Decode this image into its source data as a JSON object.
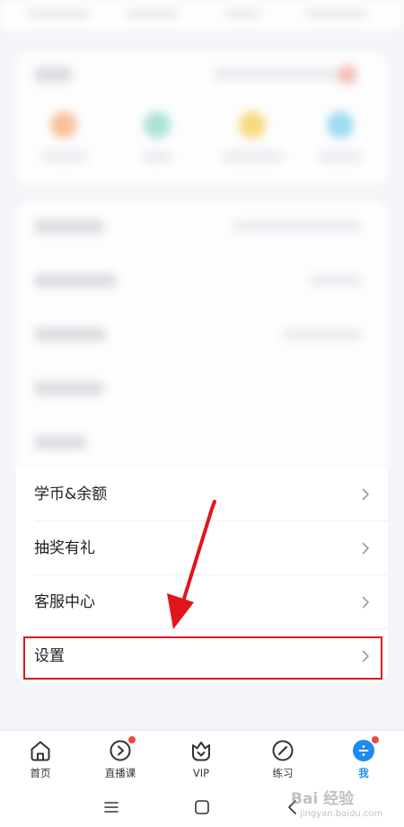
{
  "colors": {
    "accent": "#1f8bf0",
    "badge": "#f0483e",
    "annotation_red": "#e3141c",
    "background": "#f4f5f8",
    "card": "#ffffff"
  },
  "menu": {
    "items": [
      {
        "label": "学币&余额"
      },
      {
        "label": "抽奖有礼"
      },
      {
        "label": "客服中心"
      },
      {
        "label": "设置"
      }
    ]
  },
  "tabbar": {
    "items": [
      {
        "label": "首页",
        "icon": "home-icon",
        "active": false,
        "badge": false
      },
      {
        "label": "直播课",
        "icon": "live-play-icon",
        "active": false,
        "badge": true
      },
      {
        "label": "VIP",
        "icon": "vip-crown-icon",
        "active": false,
        "badge": false
      },
      {
        "label": "练习",
        "icon": "practice-pen-icon",
        "active": false,
        "badge": false
      },
      {
        "label": "我",
        "icon": "profile-icon",
        "active": true,
        "badge": true
      }
    ]
  },
  "system_nav": {
    "icons": [
      "menu-lines-icon",
      "home-square-icon",
      "back-chevron-icon"
    ]
  },
  "watermark": {
    "brand": "Bai 经验",
    "url": "jingyan.baidu.com"
  }
}
